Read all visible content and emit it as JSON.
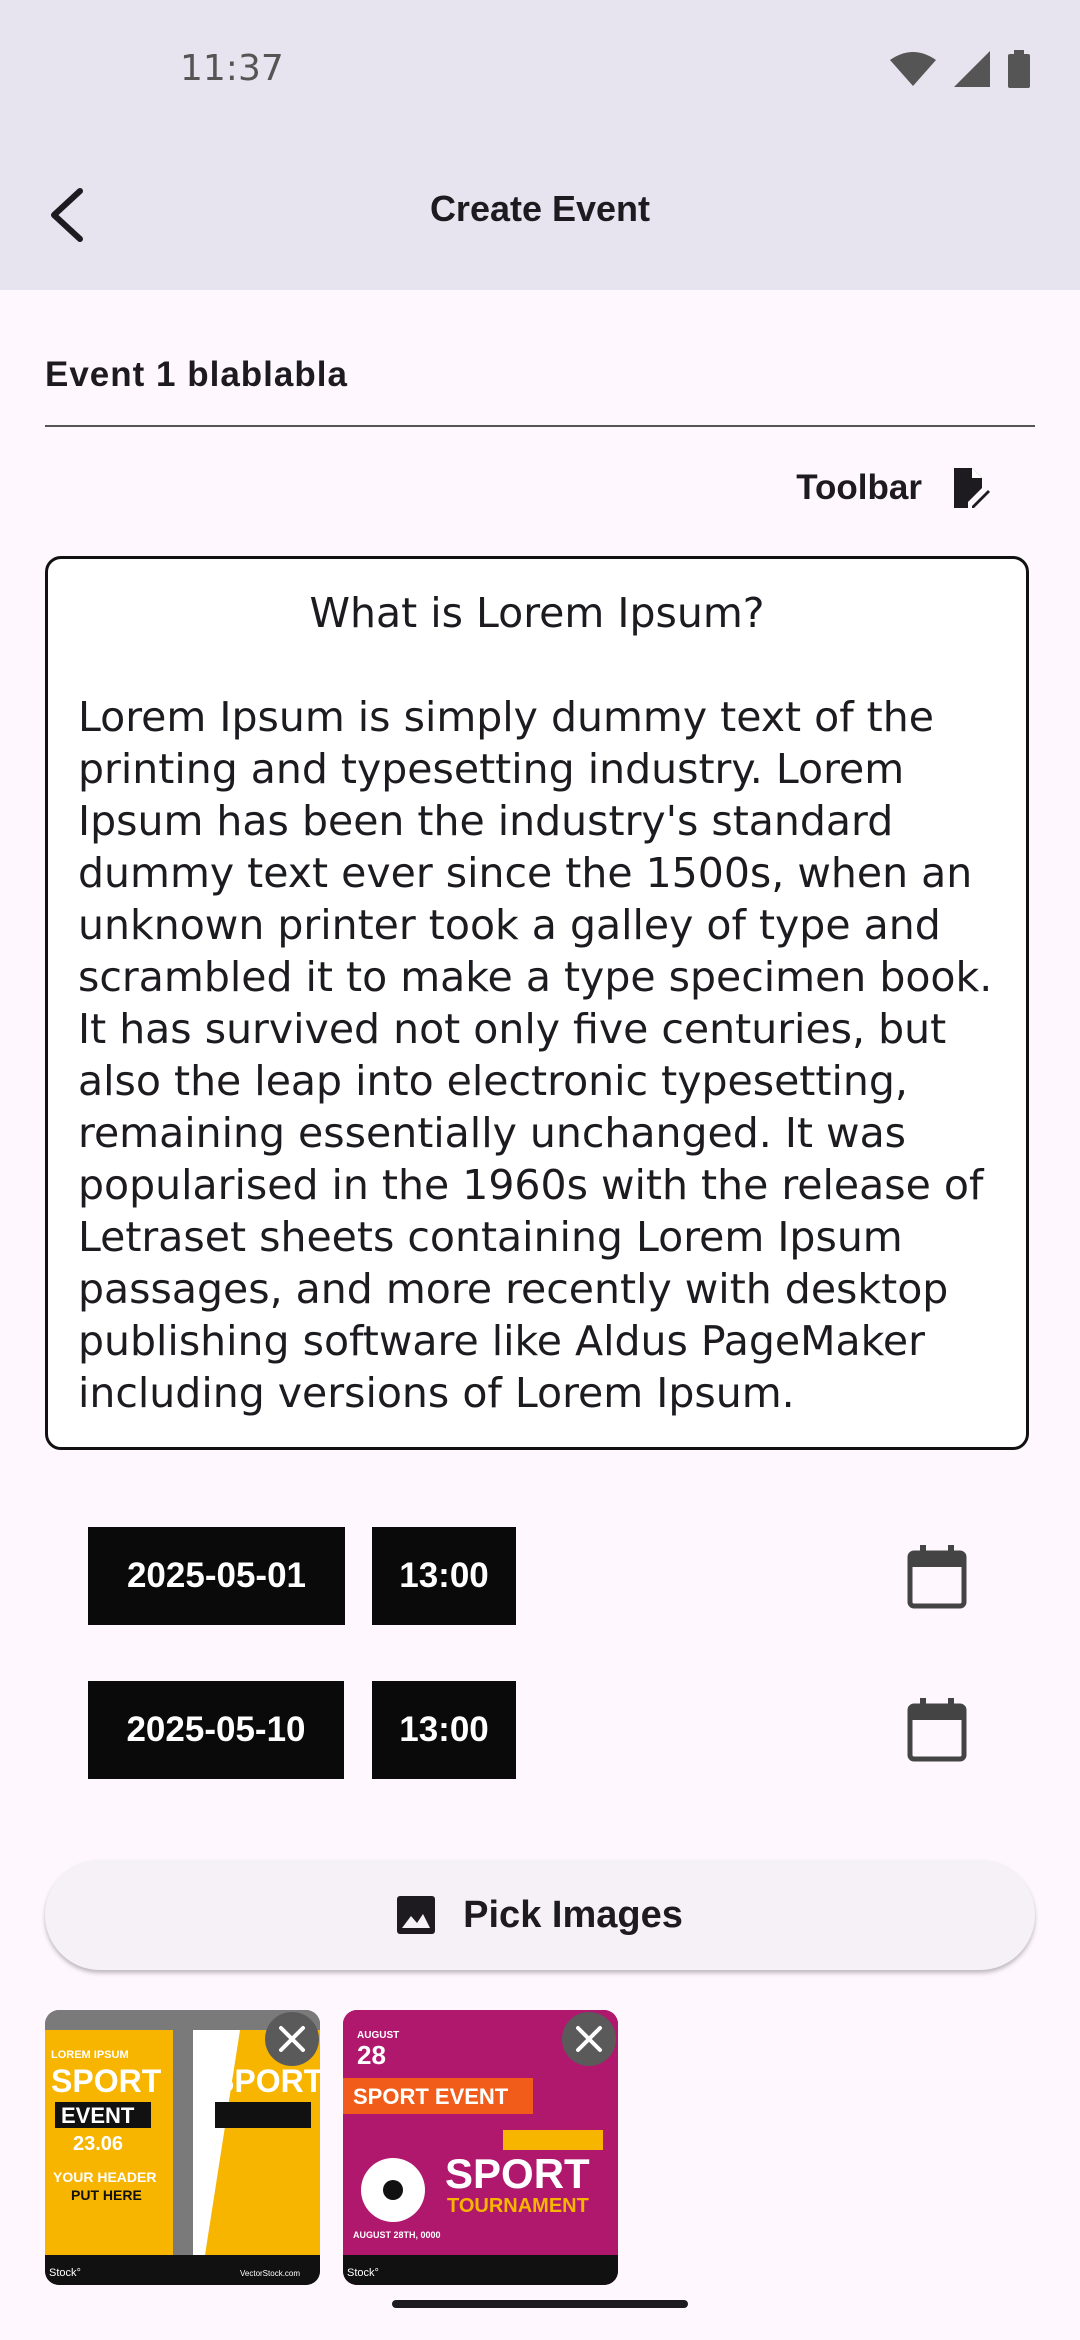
{
  "status_bar": {
    "time": "11:37"
  },
  "app_bar": {
    "title": "Create Event"
  },
  "event": {
    "title": "Event 1 blablabla"
  },
  "toolbar": {
    "label": "Toolbar"
  },
  "editor": {
    "heading": "What is Lorem Ipsum?",
    "body": "Lorem Ipsum is simply dummy text of the printing and typesetting industry. Lorem Ipsum has been the industry's standard dummy text ever since the 1500s, when an unknown printer took a galley of type and scrambled it to make a type specimen book. It has survived not only five centuries, but also the leap into electronic typesetting, remaining essentially unchanged. It was popularised in the 1960s with the release of Letraset sheets containing Lorem Ipsum passages, and more recently with desktop publishing software like Aldus PageMaker including versions of Lorem Ipsum."
  },
  "dates": [
    {
      "date": "2025-05-01",
      "time": "13:00"
    },
    {
      "date": "2025-05-10",
      "time": "13:00"
    }
  ],
  "pick_images": {
    "label": "Pick Images"
  },
  "thumbnails": [
    {
      "top": "LOREM IPSUM",
      "headline1": "SPORT",
      "headline2": "EVENT",
      "date": "23.06",
      "footer1": "YOUR HEADER",
      "footer2": "PUT HERE",
      "watermark_left": "Stock°",
      "watermark_right": "VectorStock.com"
    },
    {
      "month": "AUGUST",
      "day": "28",
      "headline1": "SPORT EVENT",
      "headline2": "SPORT",
      "headline3": "TOURNAMENT",
      "footer": "AUGUST 28TH, 0000",
      "watermark_left": "Stock°"
    }
  ],
  "colors": {
    "background": "#FEF7FE",
    "app_bar": "#E7E3EF",
    "chip": "#0A0A0A",
    "thumb1_yellow": "#F7B500",
    "thumb2_magenta": "#B0186E"
  }
}
